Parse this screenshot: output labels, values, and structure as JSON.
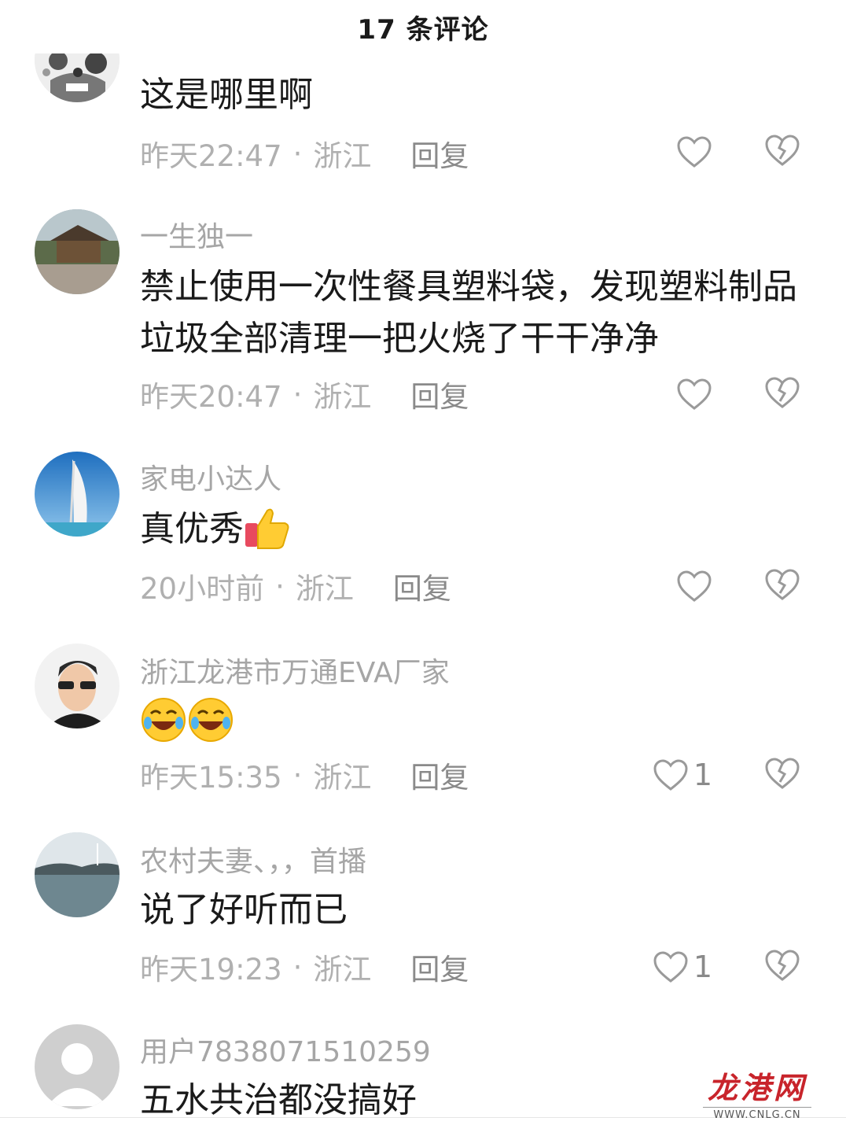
{
  "header": {
    "title": "17 条评论"
  },
  "comments": [
    {
      "username": "",
      "text": "这是哪里啊",
      "time": "昨天22:47",
      "location": "浙江",
      "reply_label": "回复",
      "likes": ""
    },
    {
      "username": "一生独一",
      "text": "禁止使用一次性餐具塑料袋，发现塑料制品垃圾全部清理一把火烧了干干净净",
      "time": "昨天20:47",
      "location": "浙江",
      "reply_label": "回复",
      "likes": ""
    },
    {
      "username": "家电小达人",
      "text": "真优秀",
      "time": "20小时前",
      "location": "浙江",
      "reply_label": "回复",
      "likes": ""
    },
    {
      "username": "浙江龙港市万通EVA厂家",
      "text": "",
      "time": "昨天15:35",
      "location": "浙江",
      "reply_label": "回复",
      "likes": "1"
    },
    {
      "username": "农村夫妻、，，首播",
      "text": "说了好听而已",
      "time": "昨天19:23",
      "location": "浙江",
      "reply_label": "回复",
      "likes": "1"
    },
    {
      "username": "用户7838071510259",
      "text": "五水共治都没搞好",
      "time": "",
      "location": "",
      "reply_label": "",
      "likes": ""
    }
  ],
  "meta_separator": "·",
  "icons": {
    "like": "heart-outline-icon",
    "dislike": "broken-heart-icon",
    "thumbs_up_emoji": "thumbs-up-emoji",
    "laughing_emoji": "rolling-laughing-emoji"
  },
  "watermark": {
    "logo": "龙港网",
    "site": "WWW.CNLG.CN"
  },
  "colors": {
    "username": "#a6a6a6",
    "meta": "#b0b0b0",
    "icon": "#9a9a9a",
    "watermark": "#c8242b"
  }
}
